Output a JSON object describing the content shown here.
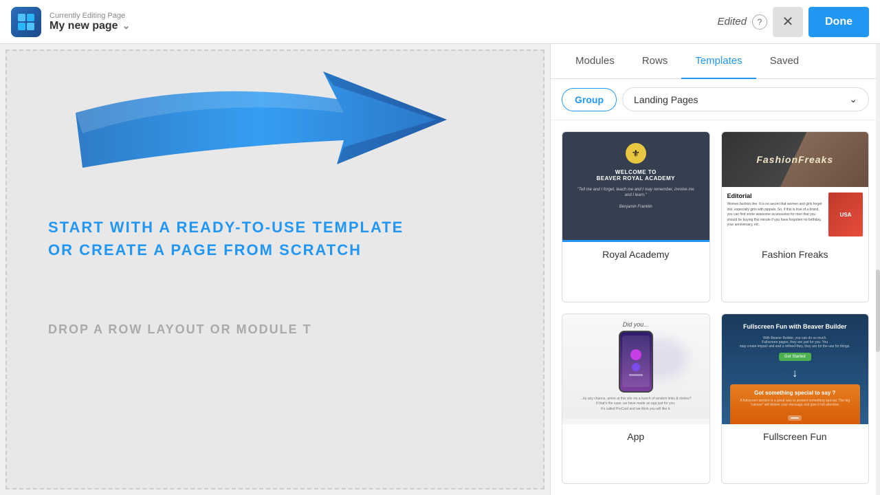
{
  "header": {
    "currently_editing_label": "Currently Editing Page",
    "page_name": "My new page",
    "edited_label": "Edited",
    "help_label": "?",
    "close_label": "✕",
    "done_label": "Done"
  },
  "canvas": {
    "main_text_line1": "START WITH A READY-TO-USE TEMPLATE",
    "main_text_line2": "OR CREATE A PAGE FROM SCRATCH",
    "drop_text": "DROP A ROW LAYOUT OR MODULE T"
  },
  "side_panel": {
    "tabs": [
      {
        "id": "modules",
        "label": "Modules"
      },
      {
        "id": "rows",
        "label": "Rows"
      },
      {
        "id": "templates",
        "label": "Templates"
      },
      {
        "id": "saved",
        "label": "Saved"
      }
    ],
    "active_tab": "templates",
    "filter_buttons": [
      {
        "id": "group",
        "label": "Group"
      },
      {
        "id": "landing-pages",
        "label": "Landing Pages"
      }
    ],
    "active_filter": "group",
    "templates": [
      {
        "id": "royal-academy",
        "name": "Royal Academy",
        "type": "royal"
      },
      {
        "id": "fashion-freaks",
        "name": "Fashion Freaks",
        "type": "fashion"
      },
      {
        "id": "app",
        "name": "App",
        "type": "app"
      },
      {
        "id": "beaver-builder",
        "name": "Fullscreen Fun",
        "type": "beaver"
      }
    ]
  }
}
